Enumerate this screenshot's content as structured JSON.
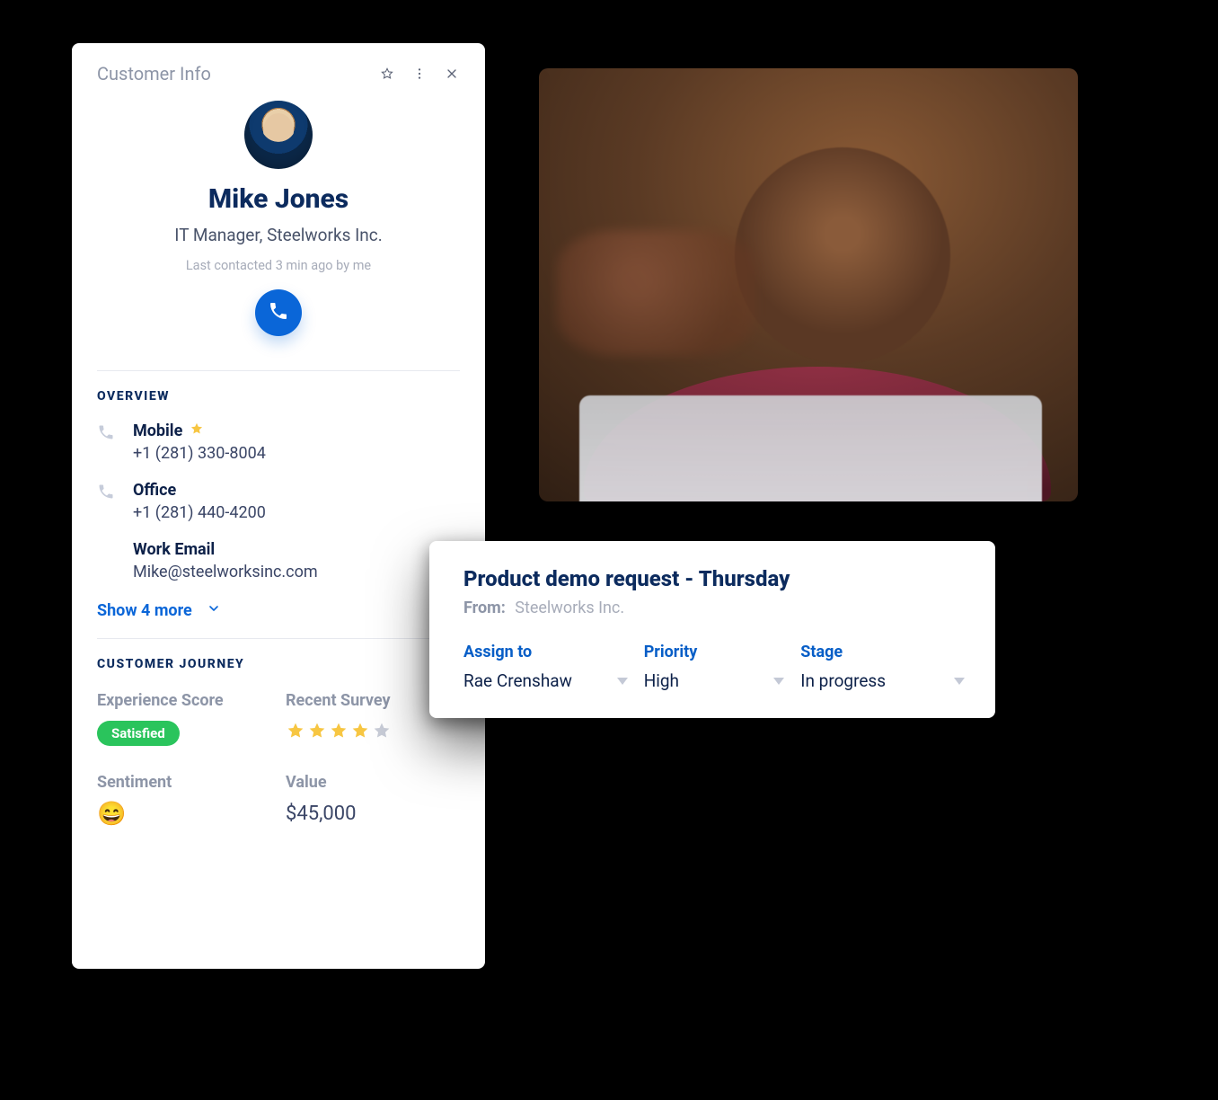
{
  "card": {
    "title": "Customer Info",
    "customer": {
      "name": "Mike Jones",
      "role": "IT Manager, Steelworks Inc.",
      "last_contact": "Last contacted 3 min ago by me"
    },
    "overview": {
      "label": "OVERVIEW",
      "items": [
        {
          "icon": "phone",
          "label": "Mobile",
          "preferred": true,
          "value": "+1 (281) 330-8004",
          "name": "contact-mobile"
        },
        {
          "icon": "phone",
          "label": "Office",
          "preferred": false,
          "value": "+1 (281) 440-4200",
          "name": "contact-office"
        },
        {
          "icon": "",
          "label": "Work Email",
          "preferred": false,
          "value": "Mike@steelworksinc.com",
          "name": "contact-work-email"
        }
      ],
      "show_more": "Show 4 more"
    },
    "journey": {
      "label": "CUSTOMER JOURNEY",
      "experience_label": "Experience Score",
      "experience_value": "Satisfied",
      "recent_survey_label": "Recent Survey",
      "recent_survey_stars": 4,
      "recent_survey_total_stars": 5,
      "sentiment_label": "Sentiment",
      "sentiment_emoji": "😄",
      "value_label": "Value",
      "value_amount": "$45,000"
    }
  },
  "ticket": {
    "title": "Product demo request - Thursday",
    "from_label": "From:",
    "from_value": "Steelworks Inc.",
    "fields": {
      "assign_to": {
        "label": "Assign to",
        "value": "Rae Crenshaw"
      },
      "priority": {
        "label": "Priority",
        "value": "High"
      },
      "stage": {
        "label": "Stage",
        "value": "In progress"
      }
    }
  }
}
